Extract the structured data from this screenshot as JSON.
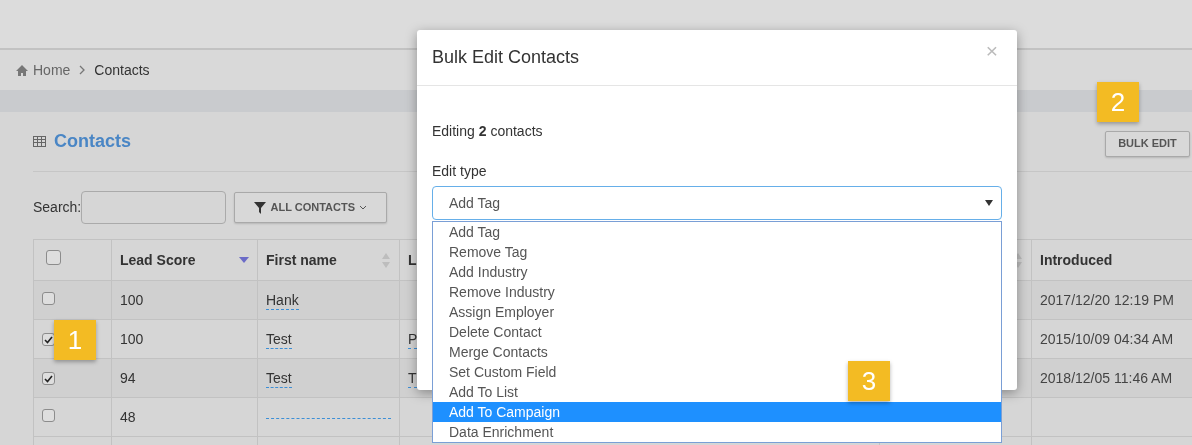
{
  "breadcrumb": [
    {
      "label": "Home",
      "kind": "home"
    },
    {
      "label": "Contacts",
      "kind": "current"
    }
  ],
  "card": {
    "title": "Contacts",
    "search_label": "Search:",
    "filter_button": "ALL CONTACTS",
    "bulk_edit_button": "BULK EDIT"
  },
  "table": {
    "select_all_checked": false,
    "columns": [
      {
        "label": "Lead Score",
        "sortable": true,
        "sorted": true
      },
      {
        "label": "First name",
        "sortable": true,
        "sorted": false
      },
      {
        "label": "L"
      },
      {
        "sortable": true,
        "sorted": false
      },
      {
        "label": "Introduced"
      }
    ],
    "rows": [
      {
        "checked": false,
        "lead_score": "100",
        "first_name": "Hank",
        "introduced": "2017/12/20 12:19 PM"
      },
      {
        "checked": true,
        "lead_score": "100",
        "first_name": "Test",
        "column_4": "P",
        "introduced": "2015/10/09 04:34 AM"
      },
      {
        "checked": true,
        "lead_score": "94",
        "first_name": "Test",
        "column_4": "T",
        "introduced": "2018/12/05 11:46 AM"
      },
      {
        "checked": false,
        "lead_score": "48"
      }
    ]
  },
  "modal": {
    "title": "Bulk Edit Contacts",
    "close": "×",
    "summary": "Editing **2** contacts",
    "field_label": "Edit type",
    "select_value": "Add Tag",
    "options": [
      {
        "label": "Add Tag",
        "selected": false
      },
      {
        "label": "Remove Tag",
        "selected": false
      },
      {
        "label": "Add Industry",
        "selected": false
      },
      {
        "label": "Remove Industry",
        "selected": false
      },
      {
        "label": "Assign Employer",
        "selected": false
      },
      {
        "label": "Delete Contact",
        "selected": false
      },
      {
        "label": "Merge Contacts",
        "selected": false
      },
      {
        "label": "Set Custom Field",
        "selected": false
      },
      {
        "label": "Add To List",
        "selected": false
      },
      {
        "label": "Add To Campaign",
        "selected": true
      },
      {
        "label": "Data Enrichment",
        "selected": false
      }
    ]
  },
  "callouts": [
    {
      "text": "1"
    },
    {
      "text": "2"
    },
    {
      "text": "3"
    }
  ]
}
